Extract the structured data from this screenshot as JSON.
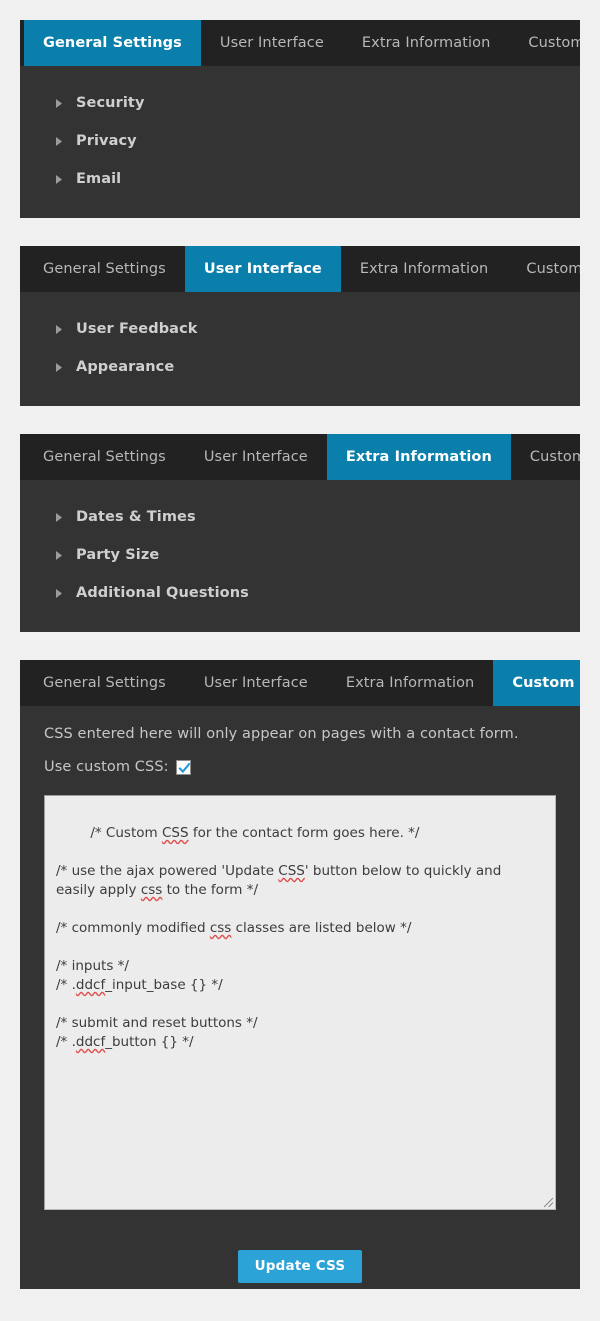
{
  "tabs": [
    {
      "id": "general-settings",
      "label": "General Settings"
    },
    {
      "id": "user-interface",
      "label": "User Interface"
    },
    {
      "id": "extra-information",
      "label": "Extra Information"
    },
    {
      "id": "custom-css",
      "label": "Custom CSS"
    }
  ],
  "colors": {
    "page_background": "#f0f0f0",
    "panel_background": "#333333",
    "tabbar_background": "#222222",
    "active_tab": "#0b7fab",
    "button_blue": "#2ba3d6",
    "tab_text": "#b8b8b8",
    "active_tab_text": "#ffffff",
    "accordion_text": "#cfcfcf",
    "textarea_background": "#ececec",
    "spellcheck_underline": "#e04b4b"
  },
  "panels": [
    {
      "name": "general-settings-panel",
      "active_tab": 0,
      "accordion": [
        {
          "id": "security",
          "label": "Security",
          "icon": "triangle-right-icon",
          "expanded": false
        },
        {
          "id": "privacy",
          "label": "Privacy",
          "icon": "triangle-right-icon",
          "expanded": false
        },
        {
          "id": "email",
          "label": "Email",
          "icon": "triangle-right-icon",
          "expanded": false
        }
      ]
    },
    {
      "name": "user-interface-panel",
      "active_tab": 1,
      "accordion": [
        {
          "id": "user-feedback",
          "label": "User Feedback",
          "icon": "triangle-right-icon",
          "expanded": false
        },
        {
          "id": "appearance",
          "label": "Appearance",
          "icon": "triangle-right-icon",
          "expanded": false
        }
      ]
    },
    {
      "name": "extra-information-panel",
      "active_tab": 2,
      "accordion": [
        {
          "id": "dates-times",
          "label": "Dates & Times",
          "icon": "triangle-right-icon",
          "expanded": false
        },
        {
          "id": "party-size",
          "label": "Party Size",
          "icon": "triangle-right-icon",
          "expanded": false
        },
        {
          "id": "additional-questions",
          "label": "Additional Questions",
          "icon": "triangle-right-icon",
          "expanded": false
        }
      ]
    }
  ],
  "custom_css_panel": {
    "name": "custom-css-panel",
    "active_tab": 3,
    "note": "CSS entered here will only appear on pages with a contact form.",
    "toggle_label": "Use custom CSS:",
    "toggle_checked": true,
    "checkbox_icon": "checkmark-icon",
    "resize_icon": "resize-grip-icon",
    "textarea": {
      "lines": [
        "/* Custom CSS for the contact form goes here. */",
        "",
        "/* use the ajax powered 'Update CSS' button below to quickly and easily apply css to the form */",
        "",
        "/* commonly modified css classes are listed below */",
        "",
        "/* inputs */",
        "/* .ddcf_input_base {} */",
        "",
        "/* submit and reset buttons */",
        "/* .ddcf_button {} */"
      ],
      "spellcheck_words": [
        "CSS",
        "css",
        "ddcf"
      ]
    },
    "update_button_label": "Update CSS"
  }
}
